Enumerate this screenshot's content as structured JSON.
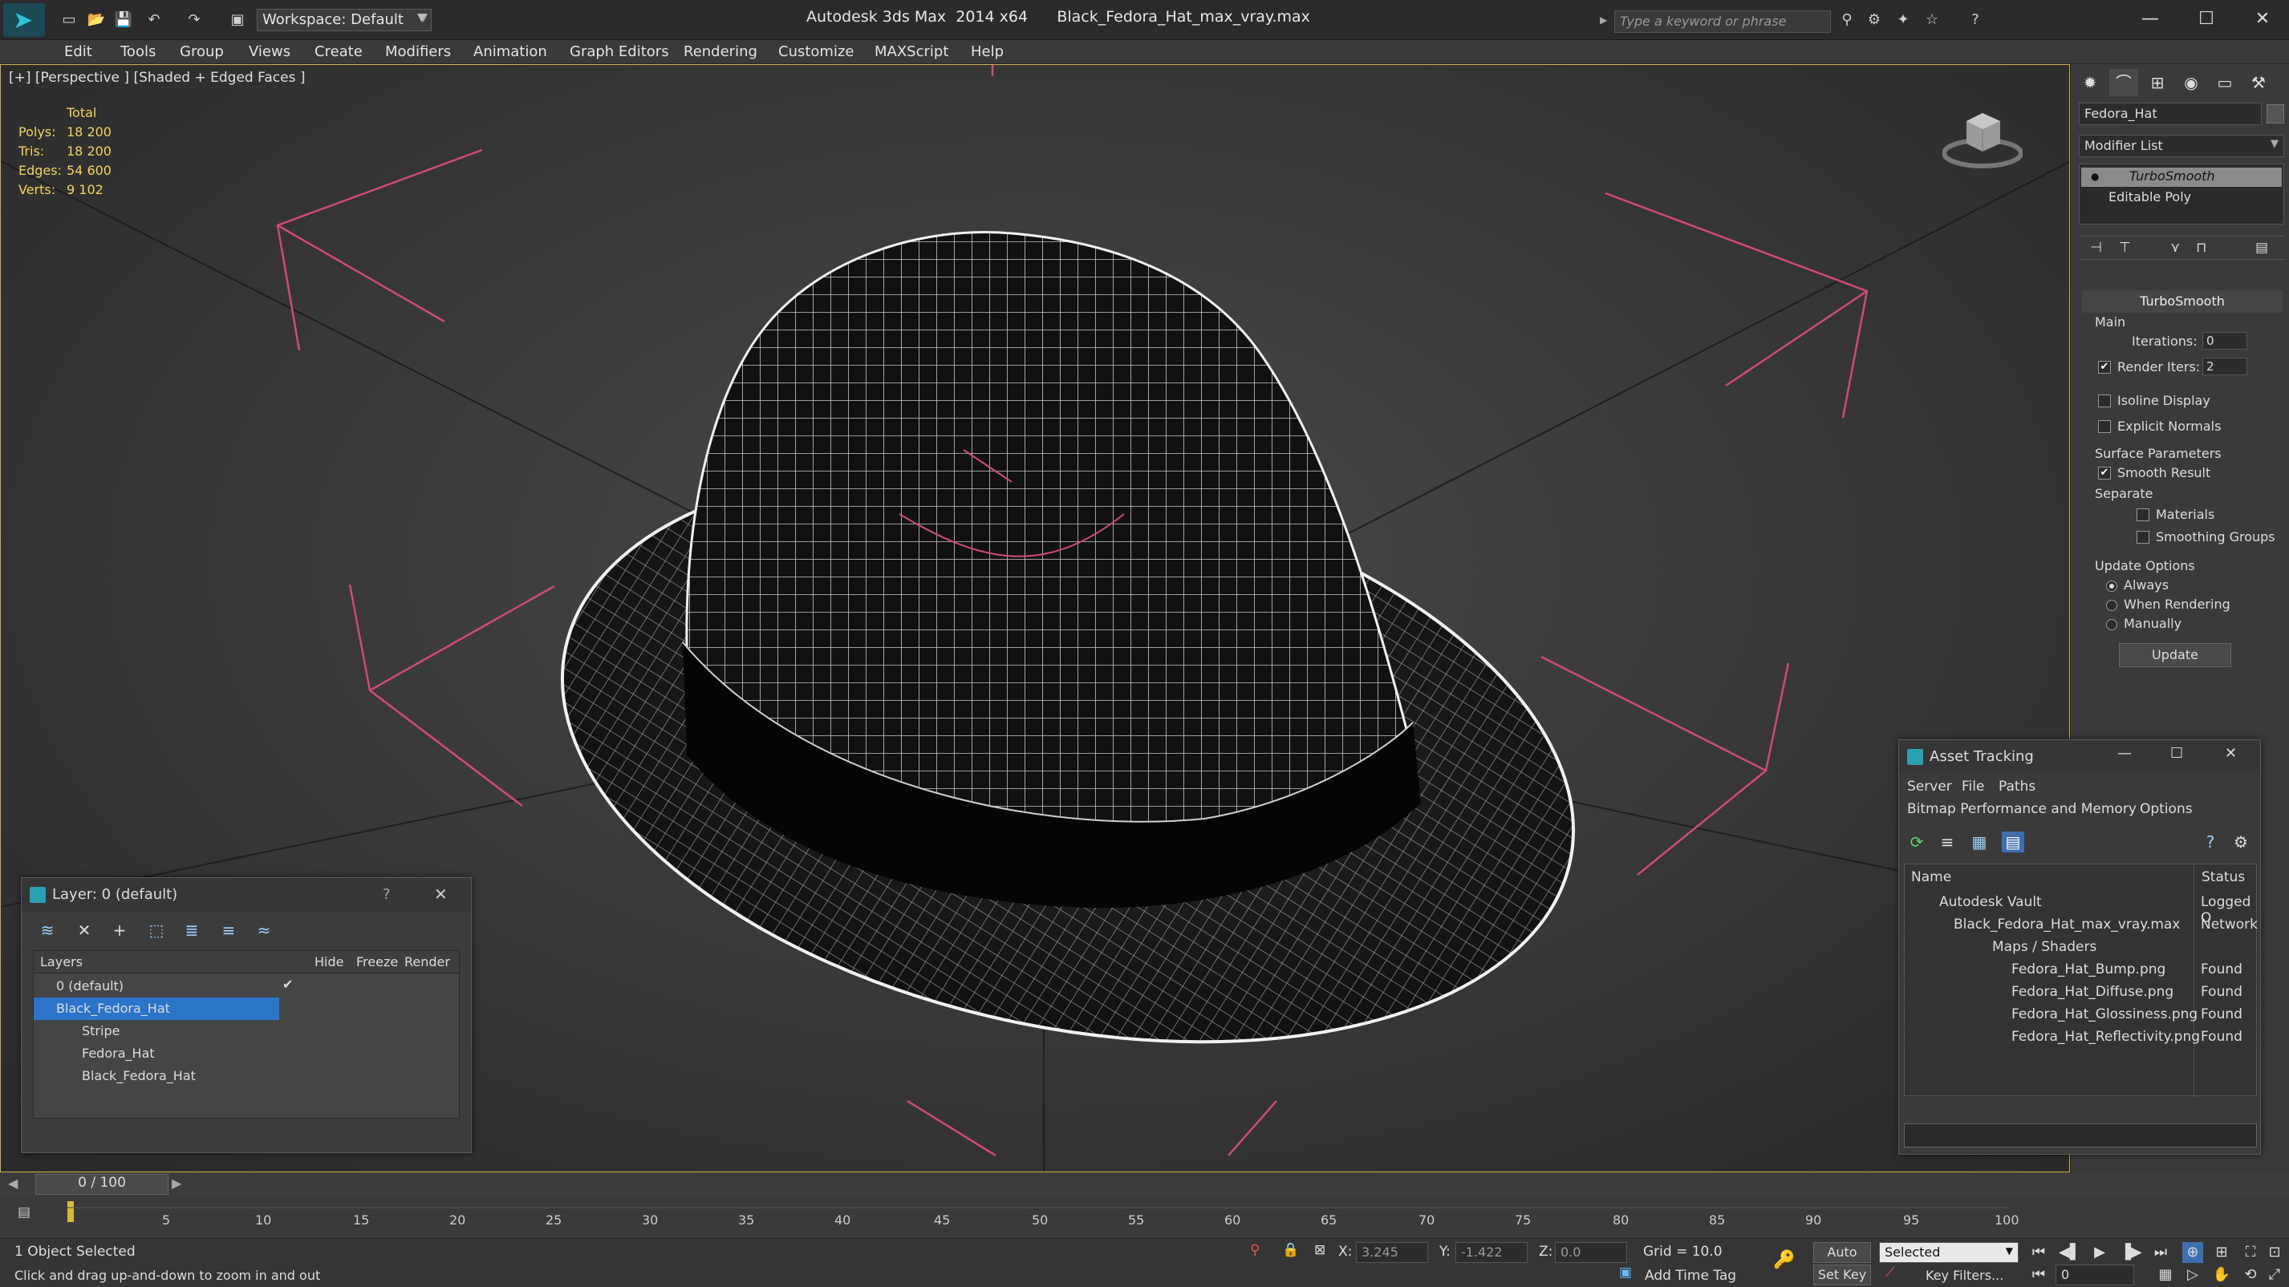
{
  "titlebar": {
    "workspace": "Workspace: Default",
    "app_title": "Autodesk 3ds Max  2014 x64",
    "file_name": "Black_Fedora_Hat_max_vray.max",
    "search_placeholder": "Type a keyword or phrase"
  },
  "menu": [
    "Edit",
    "Tools",
    "Group",
    "Views",
    "Create",
    "Modifiers",
    "Animation",
    "Graph Editors",
    "Rendering",
    "Customize",
    "MAXScript",
    "Help"
  ],
  "viewport": {
    "label": "[+] [Perspective ] [Shaded + Edged Faces ]",
    "stats_header": "Total",
    "stats": [
      {
        "label": "Polys:",
        "value": "18 200"
      },
      {
        "label": "Tris:",
        "value": "18 200"
      },
      {
        "label": "Edges:",
        "value": "54 600"
      },
      {
        "label": "Verts:",
        "value": "9 102"
      }
    ]
  },
  "command_panel": {
    "object_name": "Fedora_Hat",
    "modifier_list": "Modifier List",
    "stack": [
      "TurboSmooth",
      "Editable Poly"
    ],
    "rollout_title": "TurboSmooth",
    "main_label": "Main",
    "iterations_label": "Iterations:",
    "iterations_value": "0",
    "render_iters_label": "Render Iters:",
    "render_iters_value": "2",
    "isoline_label": "Isoline Display",
    "explicit_normals_label": "Explicit Normals",
    "surface_params_label": "Surface Parameters",
    "smooth_result_label": "Smooth Result",
    "separate_label": "Separate",
    "materials_label": "Materials",
    "smoothing_groups_label": "Smoothing Groups",
    "update_options_label": "Update Options",
    "always_label": "Always",
    "when_rendering_label": "When Rendering",
    "manually_label": "Manually",
    "update_button": "Update"
  },
  "layer_dialog": {
    "title": "Layer: 0 (default)",
    "help": "?",
    "columns": [
      "Layers",
      "Hide",
      "Freeze",
      "Render"
    ],
    "rows": [
      "0 (default)",
      "Black_Fedora_Hat",
      "Stripe",
      "Fedora_Hat",
      "Black_Fedora_Hat"
    ]
  },
  "asset_dialog": {
    "title": "Asset Tracking",
    "menu1": [
      "Server",
      "File",
      "Paths"
    ],
    "menu2": [
      "Bitmap Performance and Memory",
      "Options"
    ],
    "columns": [
      "Name",
      "Status"
    ],
    "rows": [
      {
        "name": "Autodesk Vault",
        "status": "Logged O"
      },
      {
        "name": "Black_Fedora_Hat_max_vray.max",
        "status": "Network"
      },
      {
        "name": "Maps / Shaders",
        "status": ""
      },
      {
        "name": "Fedora_Hat_Bump.png",
        "status": "Found"
      },
      {
        "name": "Fedora_Hat_Diffuse.png",
        "status": "Found"
      },
      {
        "name": "Fedora_Hat_Glossiness.png",
        "status": "Found"
      },
      {
        "name": "Fedora_Hat_Reflectivity.png",
        "status": "Found"
      }
    ]
  },
  "timeline": {
    "frame": "0 / 100",
    "ticks": [
      "5",
      "10",
      "15",
      "20",
      "25",
      "30",
      "35",
      "40",
      "45",
      "50",
      "55",
      "60",
      "65",
      "70",
      "75",
      "80",
      "85",
      "90",
      "95",
      "100"
    ]
  },
  "status": {
    "selection": "1 Object Selected",
    "prompt": "Click and drag up-and-down to zoom in and out",
    "x_label": "X:",
    "x_value": "3.245",
    "y_label": "Y:",
    "y_value": "-1.422",
    "z_label": "Z:",
    "z_value": "0.0",
    "grid": "Grid = 10.0",
    "auto_key": "Auto Key",
    "selected_dropdown": "Selected",
    "set_key": "Set Key",
    "key_filters": "Key Filters...",
    "add_time_tag": "Add Time Tag",
    "frame_field": "0"
  },
  "colors": {
    "accent_yellow": "#f4d35e",
    "selection_blue": "#2a74c9",
    "gizmo_pink": "#d04a78"
  }
}
